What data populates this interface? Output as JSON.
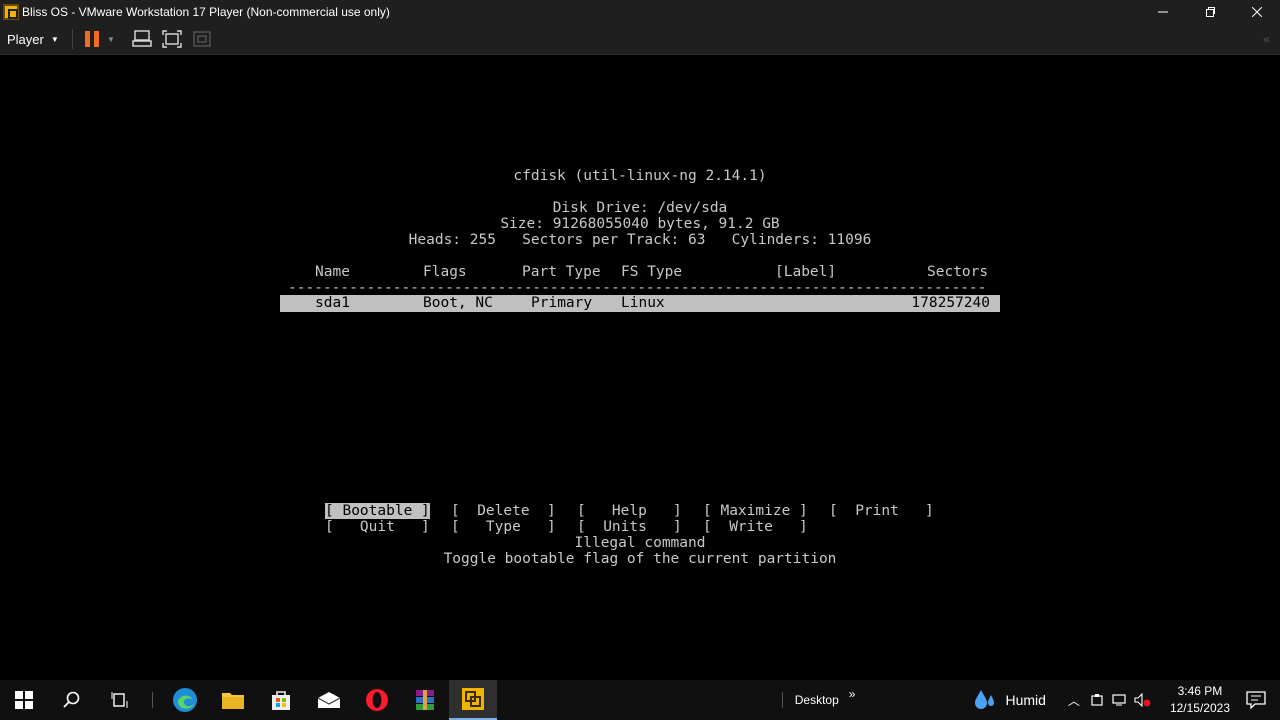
{
  "window": {
    "title": "Bliss OS - VMware Workstation 17 Player (Non-commercial use only)",
    "minimize_icon": "minimize-icon",
    "maximize_icon": "maximize-icon",
    "close_icon": "close-icon"
  },
  "toolbar": {
    "player_label": "Player",
    "accent_color": "#f26b21"
  },
  "cfdisk": {
    "heading": "cfdisk (util-linux-ng 2.14.1)",
    "disk_drive": "Disk Drive: /dev/sda",
    "size": "Size: 91268055040 bytes, 91.2 GB",
    "geometry": "Heads: 255   Sectors per Track: 63   Cylinders: 11096",
    "columns": {
      "name": "Name",
      "flags": "Flags",
      "part_type": "Part Type",
      "fs_type": "FS Type",
      "label": "[Label]",
      "sectors": "Sectors"
    },
    "divider": "--------------------------------------------------------------------------------",
    "partitions": [
      {
        "name": "sda1",
        "flags": "Boot, NC",
        "part_type": "Primary",
        "fs_type": "Linux",
        "label": "",
        "sectors": "178257240"
      }
    ],
    "menu_row1": [
      "[ Bootable ]",
      "[  Delete  ]",
      "[   Help   ]",
      "[ Maximize ]",
      "[  Print   ]"
    ],
    "menu_row2": [
      "[   Quit   ]",
      "[   Type   ]",
      "[  Units   ]",
      "[  Write   ]"
    ],
    "status": "Illegal command",
    "help_text": "Toggle bootable flag of the current partition"
  },
  "taskbar": {
    "desktop_label": "Desktop",
    "weather": "Humid",
    "time": "3:46 PM",
    "date": "12/15/2023"
  }
}
